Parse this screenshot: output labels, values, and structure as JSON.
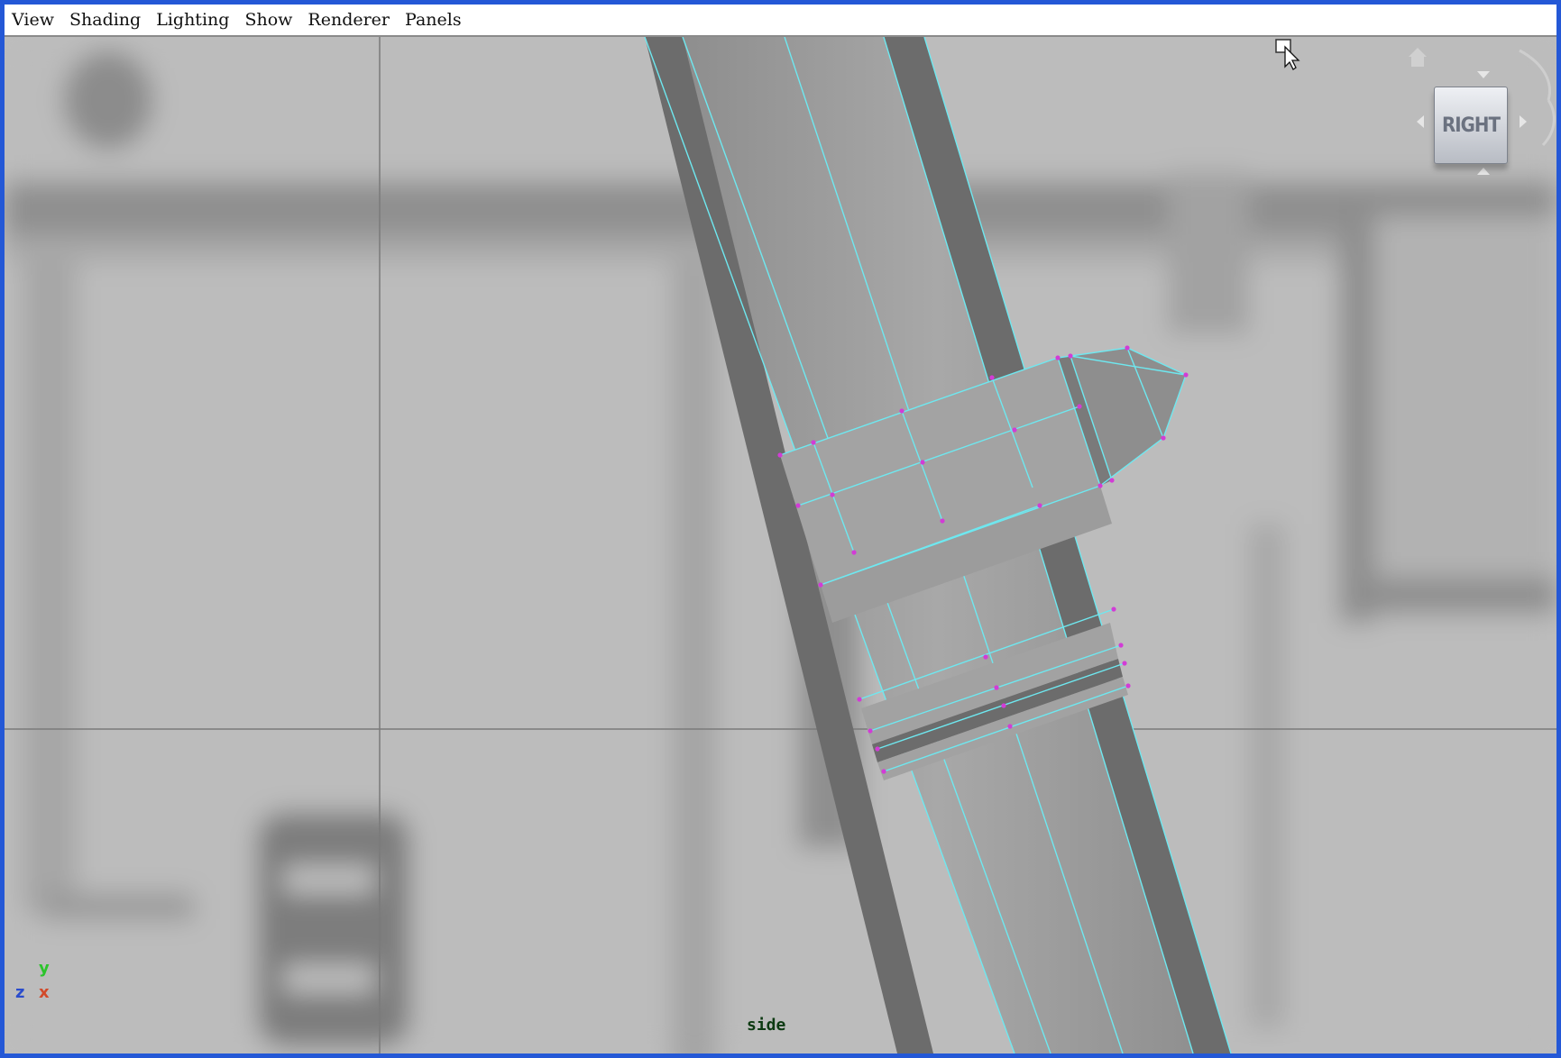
{
  "menubar": {
    "items": [
      "View",
      "Shading",
      "Lighting",
      "Show",
      "Renderer",
      "Panels"
    ]
  },
  "viewport": {
    "camera_label": "side",
    "viewcube": {
      "face_label": "RIGHT",
      "icons": [
        "home-icon",
        "rotate-arrow-icon",
        "arrow-left-icon",
        "arrow-right-icon",
        "arrow-up-icon",
        "arrow-down-icon"
      ]
    },
    "axis_indicator": {
      "y": "y",
      "z": "z",
      "x": "x",
      "colors": {
        "y": "#2ac42a",
        "z": "#2a4ccc",
        "x": "#d24a2a"
      }
    }
  },
  "colors": {
    "window_border": "#2458d6",
    "viewport_bg": "#bdbdbd",
    "wireframe_edge": "#6ee8f0",
    "vertex": "#d23cd6"
  }
}
